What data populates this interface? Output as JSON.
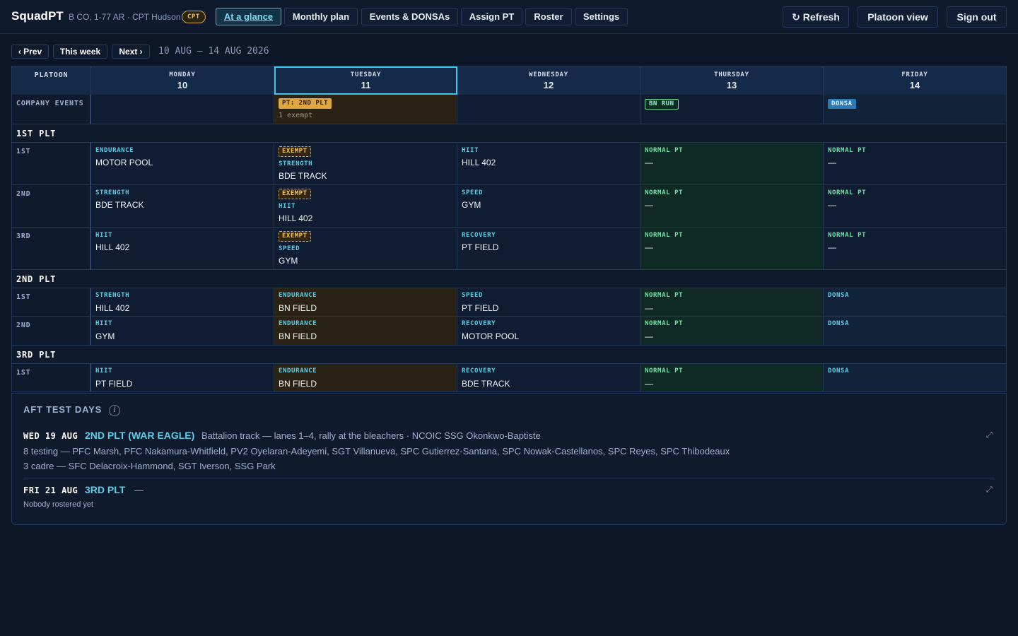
{
  "app": {
    "brand": "SquadPT",
    "unit": "B CO, 1-77 AR · CPT Hudson",
    "rank_badge": "CPT"
  },
  "nav": {
    "tabs": [
      {
        "label": "At a glance",
        "active": true
      },
      {
        "label": "Monthly plan"
      },
      {
        "label": "Events & DONSAs"
      },
      {
        "label": "Assign PT"
      },
      {
        "label": "Roster"
      },
      {
        "label": "Settings"
      }
    ],
    "refresh": "↻ Refresh",
    "platoon_view": "Platoon view",
    "sign_out": "Sign out"
  },
  "week": {
    "prev": "‹ Prev",
    "this_week": "This week",
    "next": "Next ›",
    "range": "10 AUG — 14 AUG 2026"
  },
  "grid": {
    "platoon_header": "PLATOON",
    "days": [
      {
        "name": "MONDAY",
        "num": "10"
      },
      {
        "name": "TUESDAY",
        "num": "11",
        "today": true
      },
      {
        "name": "WEDNESDAY",
        "num": "12"
      },
      {
        "name": "THURSDAY",
        "num": "13"
      },
      {
        "name": "FRIDAY",
        "num": "14"
      }
    ],
    "company_events_label": "COMPANY EVENTS",
    "company_events": {
      "tue_pill": "PT: 2ND PLT",
      "tue_note": "1 exempt",
      "thu_pill": "BN RUN",
      "fri_pill": "DONSA"
    },
    "exempt_label": "EXEMPT",
    "dash": "—",
    "platoons": [
      {
        "name": "1ST PLT",
        "squads": [
          {
            "label": "1ST",
            "cells": [
              {
                "tag": "ENDURANCE",
                "loc": "MOTOR POOL"
              },
              {
                "tag": "STRENGTH",
                "loc": "BDE TRACK"
              },
              {
                "tag": "HIIT",
                "loc": "HILL 402"
              },
              {
                "tag": "NORMAL PT",
                "loc": "—"
              },
              {
                "tag": "NORMAL PT",
                "loc": "—"
              }
            ]
          },
          {
            "label": "2ND",
            "cells": [
              {
                "tag": "STRENGTH",
                "loc": "BDE TRACK"
              },
              {
                "tag": "HIIT",
                "loc": "HILL 402"
              },
              {
                "tag": "SPEED",
                "loc": "GYM"
              },
              {
                "tag": "NORMAL PT",
                "loc": "—"
              },
              {
                "tag": "NORMAL PT",
                "loc": "—"
              }
            ]
          },
          {
            "label": "3RD",
            "cells": [
              {
                "tag": "HIIT",
                "loc": "HILL 402"
              },
              {
                "tag": "SPEED",
                "loc": "GYM"
              },
              {
                "tag": "RECOVERY",
                "loc": "PT FIELD"
              },
              {
                "tag": "NORMAL PT",
                "loc": "—"
              },
              {
                "tag": "NORMAL PT",
                "loc": "—"
              }
            ]
          }
        ]
      },
      {
        "name": "2ND PLT",
        "squads": [
          {
            "label": "1ST",
            "cells": [
              {
                "tag": "STRENGTH",
                "loc": "HILL 402"
              },
              {
                "tag": "ENDURANCE",
                "loc": "BN FIELD"
              },
              {
                "tag": "SPEED",
                "loc": "PT FIELD"
              },
              {
                "tag": "NORMAL PT",
                "loc": "—"
              },
              {
                "tag": "DONSA",
                "loc": ""
              }
            ]
          },
          {
            "label": "2ND",
            "cells": [
              {
                "tag": "HIIT",
                "loc": "GYM"
              },
              {
                "tag": "ENDURANCE",
                "loc": "BN FIELD"
              },
              {
                "tag": "RECOVERY",
                "loc": "MOTOR POOL"
              },
              {
                "tag": "NORMAL PT",
                "loc": "—"
              },
              {
                "tag": "DONSA",
                "loc": ""
              }
            ]
          }
        ]
      },
      {
        "name": "3RD PLT",
        "squads": [
          {
            "label": "1ST",
            "cells": [
              {
                "tag": "HIIT",
                "loc": "PT FIELD"
              },
              {
                "tag": "ENDURANCE",
                "loc": "BN FIELD"
              },
              {
                "tag": "RECOVERY",
                "loc": "BDE TRACK"
              },
              {
                "tag": "NORMAL PT",
                "loc": "—"
              },
              {
                "tag": "DONSA",
                "loc": ""
              }
            ]
          }
        ]
      }
    ]
  },
  "aft": {
    "title": "AFT TEST DAYS",
    "info_icon": "i",
    "entries": [
      {
        "date": "WED 19 AUG",
        "platoon": "2ND PLT (WAR EAGLE)",
        "desc": "Battalion track — lanes 1–4, rally at the bleachers · NCOIC SSG Okonkwo-Baptiste",
        "testing": "8 testing — PFC Marsh, PFC Nakamura-Whitfield, PV2 Oyelaran-Adeyemi, SGT Villanueva, SPC Gutierrez-Santana, SPC Nowak-Castellanos, SPC Reyes, SPC Thibodeaux",
        "cadre": "3 cadre — SFC Delacroix-Hammond, SGT Iverson, SSG Park"
      },
      {
        "date": "FRI 21 AUG",
        "platoon": "3RD PLT",
        "desc": "—",
        "note": "Nobody rostered yet"
      }
    ]
  },
  "colors": {
    "accent": "#3fc6ec",
    "amber": "#e0a640",
    "green": "#6fe3a8",
    "background": "#0d1627"
  }
}
